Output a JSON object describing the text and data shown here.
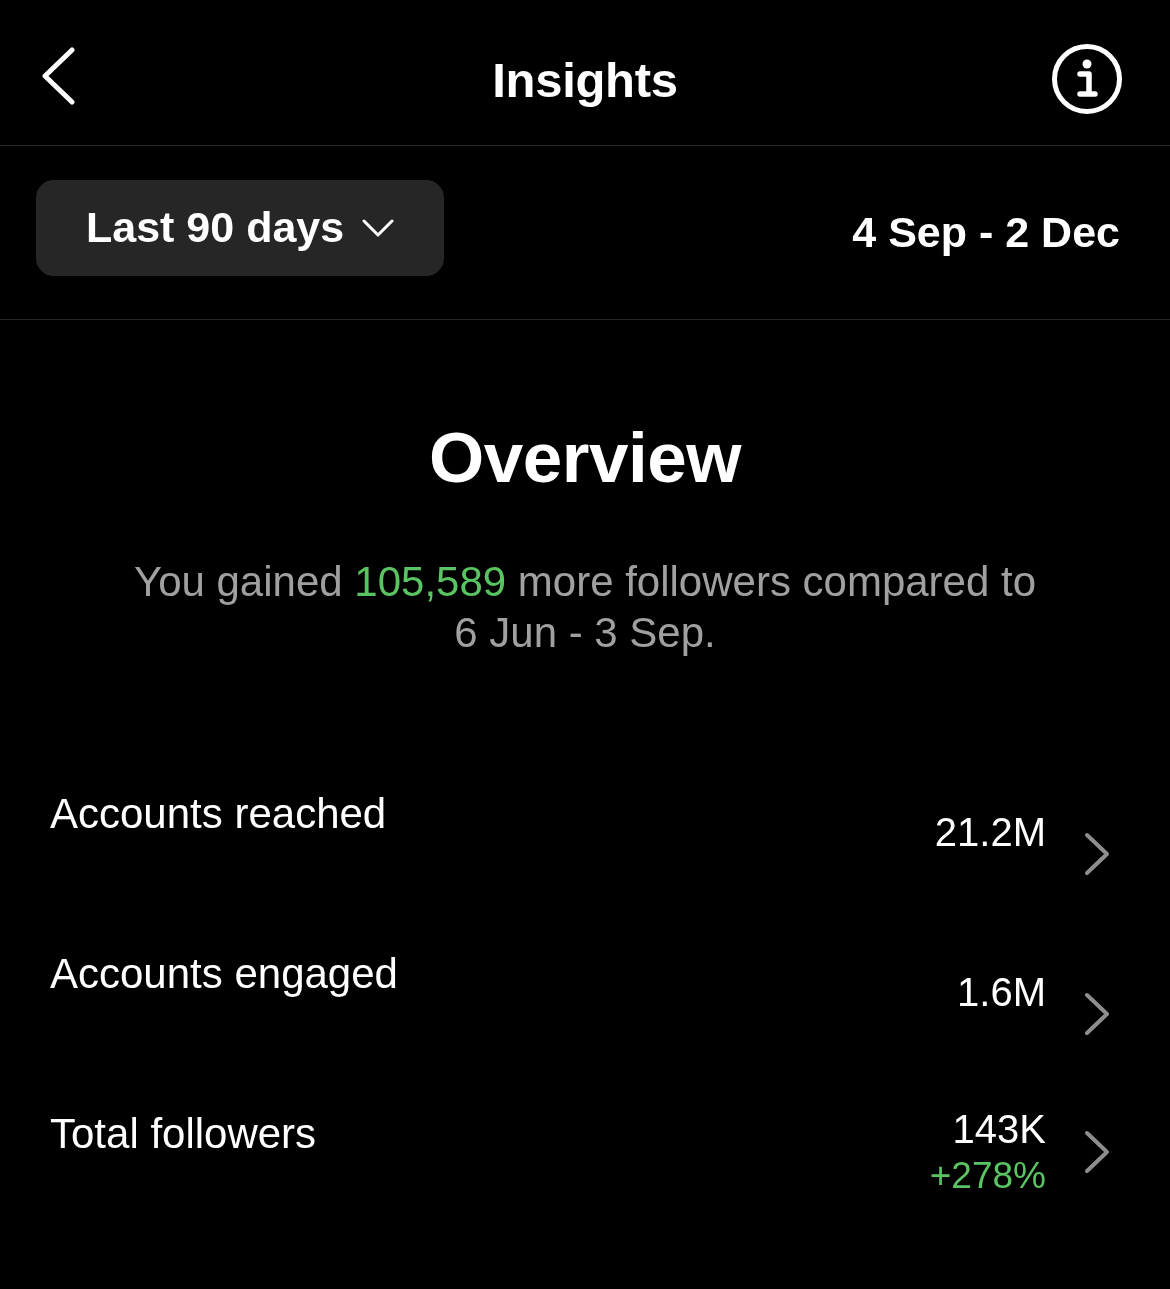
{
  "header": {
    "title": "Insights"
  },
  "filter": {
    "range_label": "Last 90 days",
    "date_range": "4 Sep - 2 Dec"
  },
  "overview": {
    "title": "Overview",
    "summary": {
      "before": "You gained",
      "highlight": "105,589",
      "after": "more followers compared to",
      "period": "6 Jun - 3 Sep."
    }
  },
  "metrics": [
    {
      "label": "Accounts reached",
      "value": "21.2M"
    },
    {
      "label": "Accounts engaged",
      "value": "1.6M"
    },
    {
      "label": "Total followers",
      "value": "143K",
      "change": "+278%"
    }
  ]
}
